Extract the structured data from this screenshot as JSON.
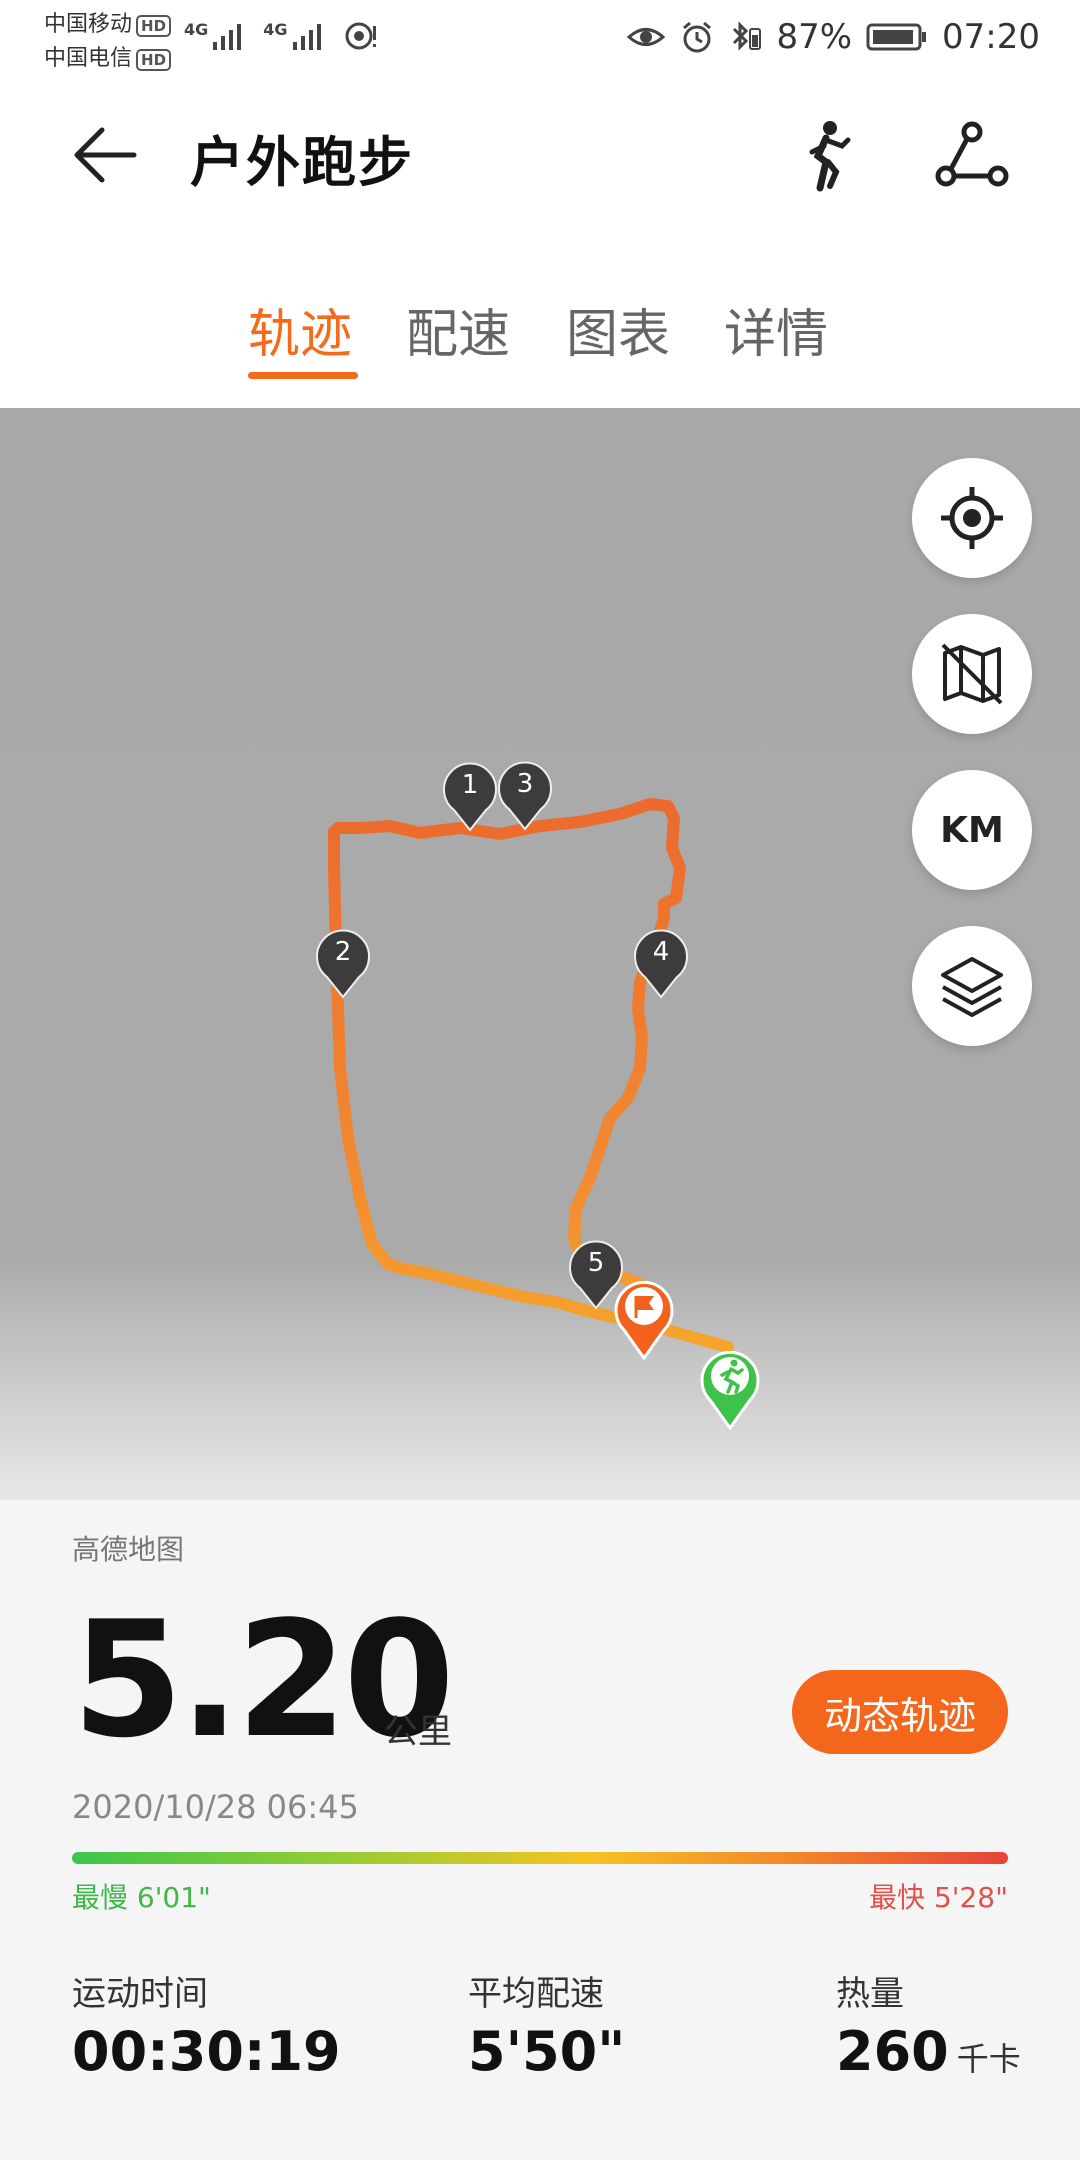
{
  "status_bar": {
    "carrier1": "中国移动",
    "carrier2": "中国电信",
    "hd": "HD",
    "net1": "4G",
    "net2": "4G",
    "battery": "87%",
    "time": "07:20"
  },
  "header": {
    "title": "户外跑步",
    "icons": [
      "back-arrow-icon",
      "runner-icon",
      "share-route-icon"
    ]
  },
  "tabs": [
    "轨迹",
    "配速",
    "图表",
    "详情"
  ],
  "active_tab": 0,
  "map": {
    "provider": "高德地图",
    "buttons": [
      "locate-icon",
      "map-toggle-icon",
      "KM",
      "layers-icon"
    ],
    "km_label": "KM",
    "markers": [
      "1",
      "2",
      "3",
      "4",
      "5"
    ]
  },
  "summary": {
    "distance": "5.20",
    "distance_unit": "公里",
    "dynamic_track_button": "动态轨迹",
    "datetime": "2020/10/28 06:45",
    "slowest_label": "最慢 6'01\"",
    "fastest_label": "最快 5'28\""
  },
  "stats": [
    {
      "label": "运动时间",
      "value": "00:30:19",
      "unit": ""
    },
    {
      "label": "平均配速",
      "value": "5'50\"",
      "unit": ""
    },
    {
      "label": "热量",
      "value": "260",
      "unit": "千卡"
    }
  ],
  "colors": {
    "accent": "#f46b1b",
    "route": "#f08a30",
    "start_marker": "#3ec24a",
    "end_marker": "#f2611d",
    "km_marker": "#3c3c3c"
  }
}
